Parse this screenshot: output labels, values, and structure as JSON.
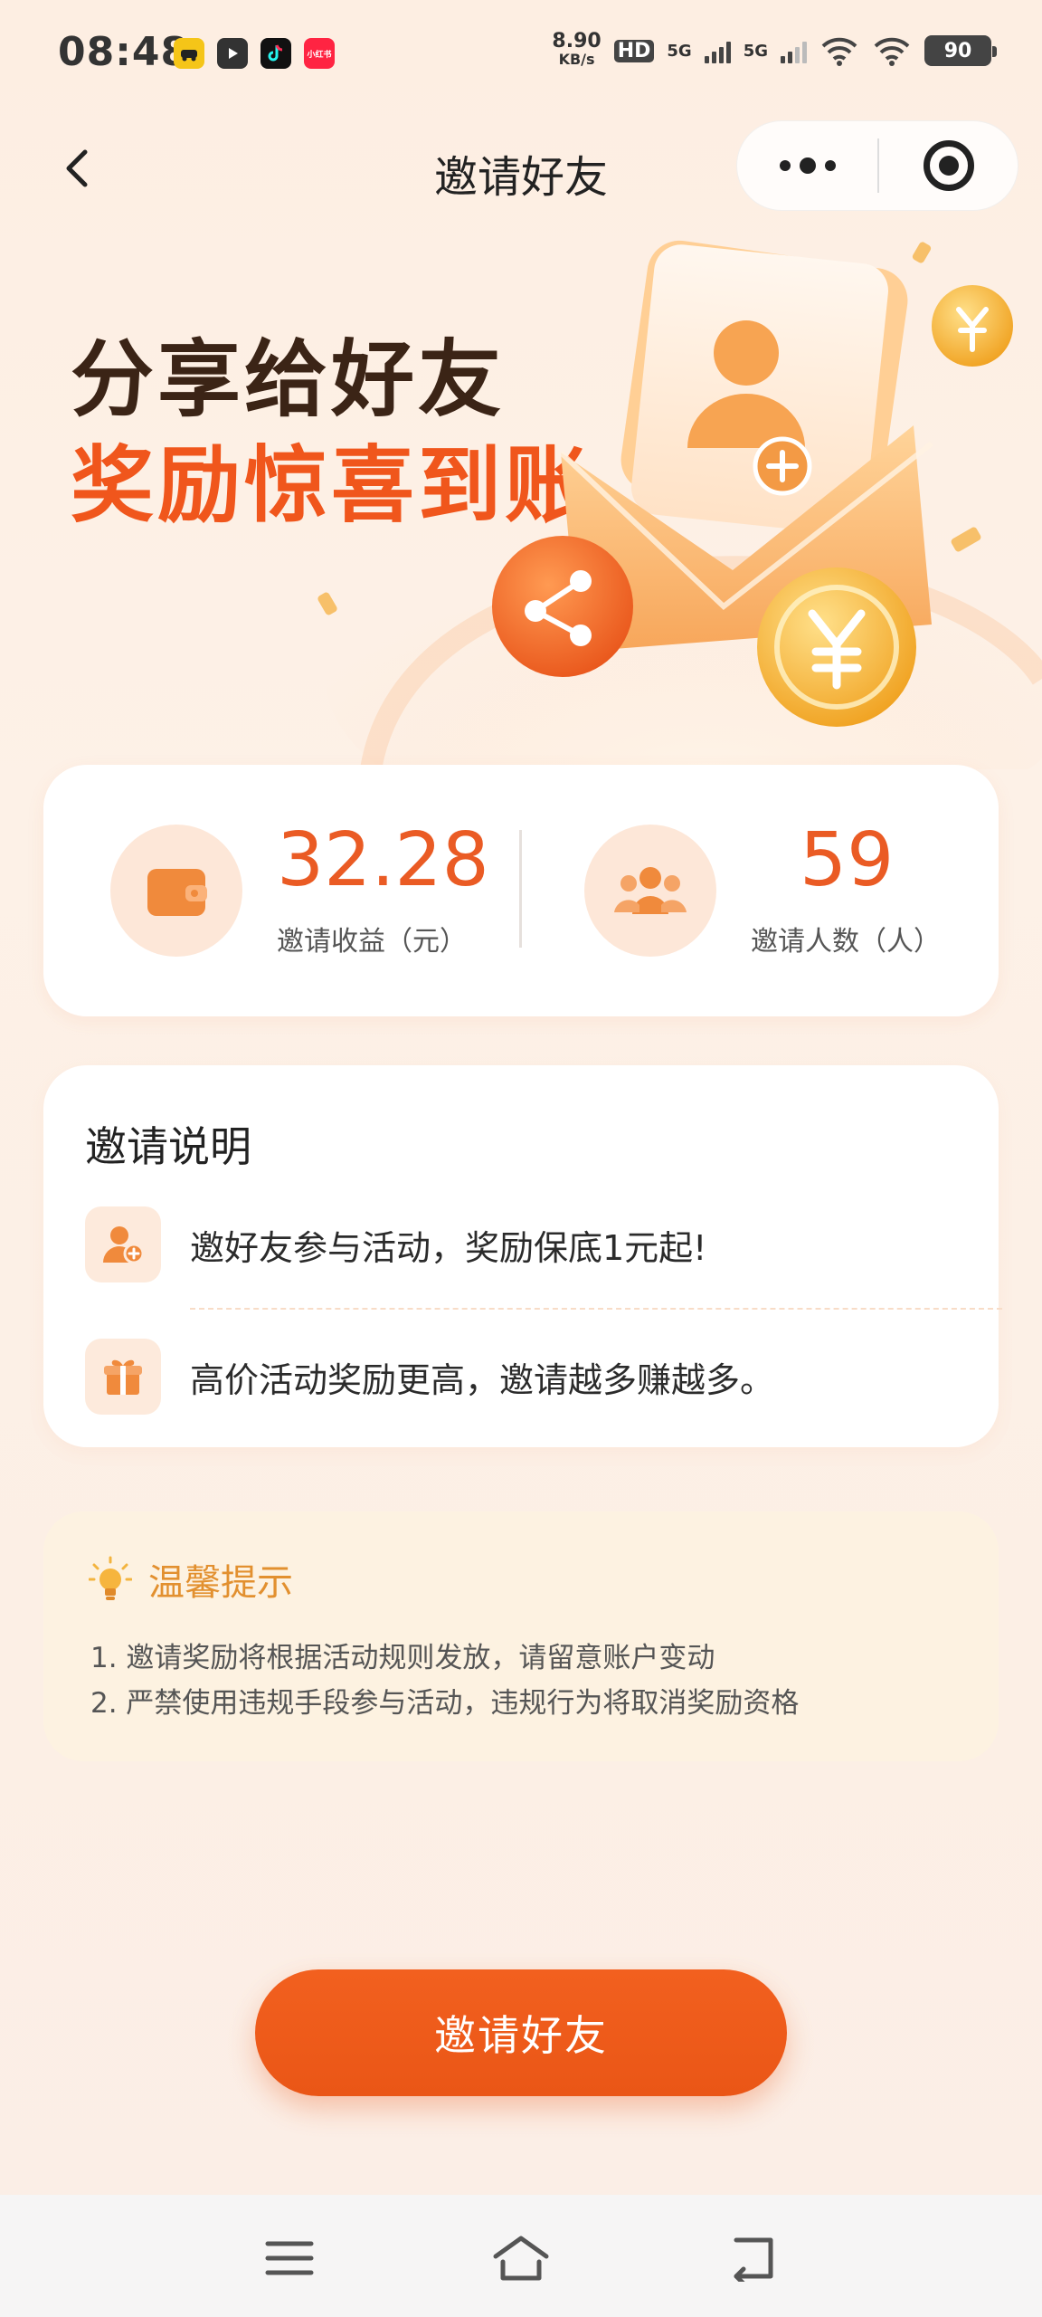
{
  "status_bar": {
    "time": "08:48",
    "net_speed_value": "8.90",
    "net_speed_unit": "KB/s",
    "hd_label": "HD",
    "network_1": "5G",
    "network_2": "5G",
    "battery": "90",
    "apps": [
      "car-app-icon",
      "video-app-icon",
      "tiktok-icon",
      "xiaohongshu-icon"
    ],
    "xiaohongshu_label": "小红书"
  },
  "nav": {
    "title": "邀请好友"
  },
  "hero": {
    "line1": "分享给好友",
    "line2": "奖励惊喜到账"
  },
  "stats": {
    "earnings_value": "32.28",
    "earnings_label": "邀请收益（元）",
    "invitees_value": "59",
    "invitees_label": "邀请人数（人）"
  },
  "instructions": {
    "title": "邀请说明",
    "items": [
      {
        "icon": "add-user-icon",
        "text": "邀好友参与活动，奖励保底1元起!"
      },
      {
        "icon": "gift-icon",
        "text": "高价活动奖励更高，邀请越多赚越多。"
      }
    ]
  },
  "tips": {
    "title": "温馨提示",
    "lines": [
      "1. 邀请奖励将根据活动规则发放，请留意账户变动",
      "2. 严禁使用违规手段参与活动，违规行为将取消奖励资格"
    ]
  },
  "invite_button": {
    "label": "邀请好友"
  },
  "colors": {
    "accent": "#ea5b24",
    "dark_title": "#3b2416",
    "tip_title": "#e2902f",
    "icon_orange": "#f08a3c"
  }
}
